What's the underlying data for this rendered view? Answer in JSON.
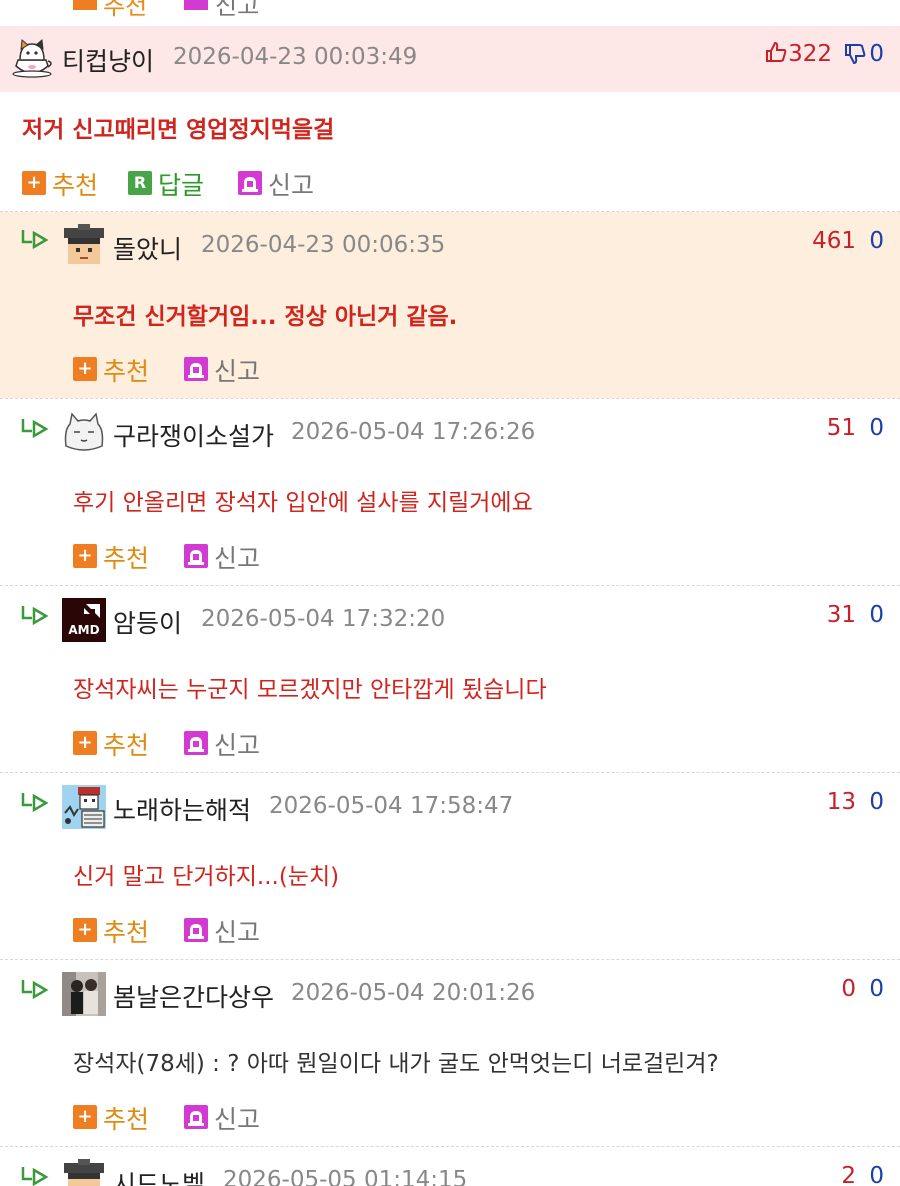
{
  "actions": {
    "recommend": "추천",
    "reply": "답글",
    "report": "신고"
  },
  "comments": [
    {
      "nick": "티컵냥이",
      "date": "2026-04-23 00:03:49",
      "up": "322",
      "down": "0",
      "text": "저거 신고때리면 영업정지먹을걸"
    },
    {
      "nick": "돌았니",
      "date": "2026-04-23 00:06:35",
      "up": "461",
      "down": "0",
      "text": "무조건 신거할거임... 정상 아닌거 같음."
    },
    {
      "nick": "구라쟁이소설가",
      "date": "2026-05-04 17:26:26",
      "up": "51",
      "down": "0",
      "text": "후기 안올리면 장석자 입안에 설사를 지릴거에요"
    },
    {
      "nick": "암등이",
      "date": "2026-05-04 17:32:20",
      "up": "31",
      "down": "0",
      "text": "장석자씨는 누군지 모르겠지만 안타깝게 됬습니다"
    },
    {
      "nick": "노래하는해적",
      "date": "2026-05-04 17:58:47",
      "up": "13",
      "down": "0",
      "text": "신거 말고 단거하지...(눈치)"
    },
    {
      "nick": "봄날은간다상우",
      "date": "2026-05-04 20:01:26",
      "up": "0",
      "down": "0",
      "text": "장석자(78세) : ? 아따 뭔일이다 내가 굴도 안먹엇는디 너로걸린겨?"
    },
    {
      "nick": "시드노벨",
      "date": "2026-05-05 01:14:15",
      "up": "2",
      "down": "0"
    }
  ],
  "colors": {
    "best_bg": "#fde7e7",
    "highlight_bg": "#fdeede",
    "comment_text": "#d0251e",
    "upvote": "#c8202b",
    "downvote": "#1a3fa8"
  },
  "icons": {
    "thumbs_up": "thumbs-up-icon",
    "thumbs_down": "thumbs-down-icon",
    "reply_arrow": "reply-arrow-icon",
    "recommend": "plus-icon",
    "reply": "r-icon",
    "report": "siren-icon"
  }
}
